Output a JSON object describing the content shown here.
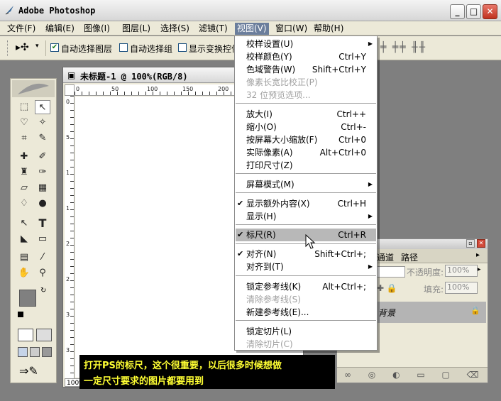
{
  "window": {
    "title": "Adobe Photoshop",
    "minimize": "_",
    "maximize": "□",
    "close": "✕"
  },
  "menubar": [
    {
      "label": "文件(F)"
    },
    {
      "label": "编辑(E)"
    },
    {
      "label": "图像(I)"
    },
    {
      "label": "图层(L)"
    },
    {
      "label": "选择(S)"
    },
    {
      "label": "滤镜(T)"
    },
    {
      "label": "视图(V)"
    },
    {
      "label": "窗口(W)"
    },
    {
      "label": "帮助(H)"
    }
  ],
  "options": {
    "auto_select_layer": "自动选择图层",
    "auto_select_group": "自动选择组",
    "show_transform": "显示变换控件"
  },
  "document": {
    "title": "未标题-1 @ 100%(RGB/8)",
    "zoom": "100%",
    "ruler_h": [
      "0",
      "50",
      "100",
      "150",
      "200"
    ],
    "ruler_v": [
      "0",
      "5",
      "1",
      "1",
      "2",
      "2",
      "3",
      "3"
    ]
  },
  "panel": {
    "tab_channels": "通道",
    "tab_paths": "路径",
    "opacity_label": "不透明度:",
    "opacity_value": "100%",
    "fill_label": "填充:",
    "fill_value": "100%",
    "layer_name": "背景"
  },
  "view_menu": [
    {
      "label": "校样设置(U)",
      "shortcut": "",
      "submenu": true
    },
    {
      "label": "校样颜色(Y)",
      "shortcut": "Ctrl+Y"
    },
    {
      "label": "色域警告(W)",
      "shortcut": "Shift+Ctrl+Y"
    },
    {
      "label": "像素长宽比校正(P)",
      "shortcut": "",
      "disabled": true
    },
    {
      "label": "32 位预览选项...",
      "shortcut": "",
      "disabled": true
    },
    {
      "sep": true
    },
    {
      "label": "放大(I)",
      "shortcut": "Ctrl++"
    },
    {
      "label": "缩小(O)",
      "shortcut": "Ctrl+-"
    },
    {
      "label": "按屏幕大小缩放(F)",
      "shortcut": "Ctrl+0"
    },
    {
      "label": "实际像素(A)",
      "shortcut": "Alt+Ctrl+0"
    },
    {
      "label": "打印尺寸(Z)",
      "shortcut": ""
    },
    {
      "sep": true
    },
    {
      "label": "屏幕模式(M)",
      "shortcut": "",
      "submenu": true
    },
    {
      "sep": true
    },
    {
      "label": "显示额外内容(X)",
      "shortcut": "Ctrl+H",
      "checked": true
    },
    {
      "label": "显示(H)",
      "shortcut": "",
      "submenu": true
    },
    {
      "sep": true
    },
    {
      "label": "标尺(R)",
      "shortcut": "Ctrl+R",
      "checked": true,
      "highlighted": true
    },
    {
      "sep": true
    },
    {
      "label": "对齐(N)",
      "shortcut": "Shift+Ctrl+;",
      "checked": true
    },
    {
      "label": "对齐到(T)",
      "shortcut": "",
      "submenu": true
    },
    {
      "sep": true
    },
    {
      "label": "锁定参考线(K)",
      "shortcut": "Alt+Ctrl+;"
    },
    {
      "label": "清除参考线(S)",
      "shortcut": "",
      "disabled": true
    },
    {
      "label": "新建参考线(E)...",
      "shortcut": ""
    },
    {
      "sep": true
    },
    {
      "label": "锁定切片(L)",
      "shortcut": ""
    },
    {
      "label": "清除切片(C)",
      "shortcut": "",
      "disabled": true
    }
  ],
  "annotation": {
    "line1": "打开PS的标尺，这个很重要，以后很多时候想做",
    "line2": "一定尺寸要求的图片都要用到"
  }
}
